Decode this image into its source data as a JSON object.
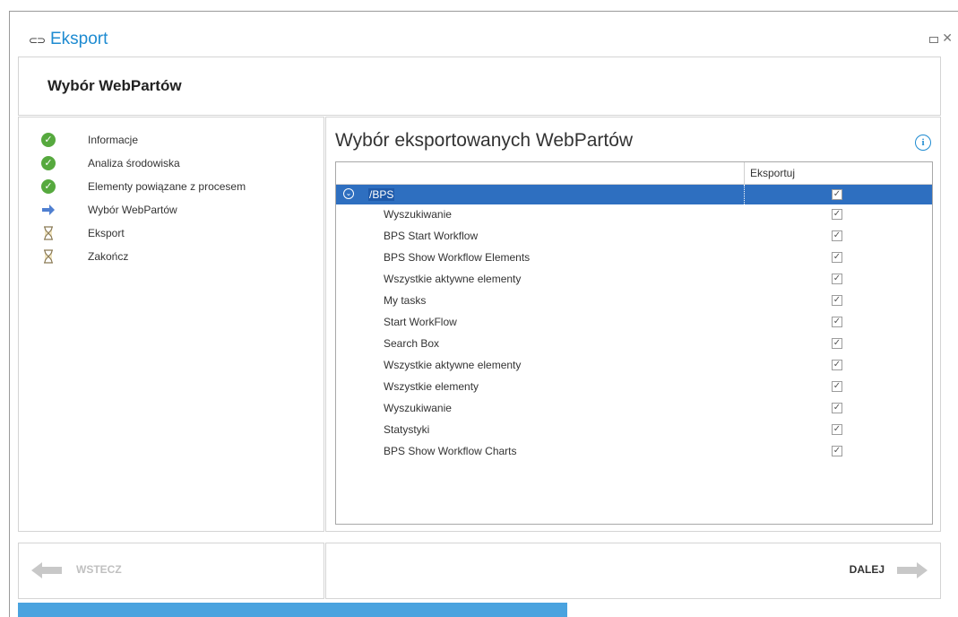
{
  "window": {
    "icon": "link-icon",
    "title": "Eksport",
    "controls": {
      "maximize": "maximize-icon",
      "close": "✕"
    }
  },
  "header": {
    "title": "Wybór WebPartów"
  },
  "steps": [
    {
      "label": "Informacje",
      "state": "done",
      "icon": "check-icon"
    },
    {
      "label": "Analiza środowiska",
      "state": "done",
      "icon": "check-icon"
    },
    {
      "label": "Elementy powiązane z procesem",
      "state": "done",
      "icon": "check-icon"
    },
    {
      "label": "Wybór WebPartów",
      "state": "current",
      "icon": "arrow-right-icon"
    },
    {
      "label": "Eksport",
      "state": "pending",
      "icon": "hourglass-icon"
    },
    {
      "label": "Zakończ",
      "state": "pending",
      "icon": "hourglass-icon"
    }
  ],
  "content": {
    "title": "Wybór eksportowanych WebPartów",
    "info_icon": "i",
    "grid": {
      "column_header": "Eksportuj",
      "root": {
        "name": "/BPS",
        "checked": true
      },
      "rows": [
        {
          "name": "Wyszukiwanie",
          "checked": true
        },
        {
          "name": "BPS Start Workflow",
          "checked": true
        },
        {
          "name": "BPS Show Workflow Elements",
          "checked": true
        },
        {
          "name": "Wszystkie aktywne elementy",
          "checked": true
        },
        {
          "name": "My tasks",
          "checked": true
        },
        {
          "name": "Start WorkFlow",
          "checked": true
        },
        {
          "name": "Search Box",
          "checked": true
        },
        {
          "name": "Wszystkie aktywne elementy",
          "checked": true
        },
        {
          "name": "Wszystkie elementy",
          "checked": true
        },
        {
          "name": "Wyszukiwanie",
          "checked": true
        },
        {
          "name": "Statystyki",
          "checked": true
        },
        {
          "name": "BPS Show Workflow Charts",
          "checked": true
        }
      ]
    }
  },
  "nav": {
    "back_label": "WSTECZ",
    "back_enabled": false,
    "next_label": "DALEJ"
  },
  "progress": {
    "fraction": 0.595,
    "color": "#4aa3df"
  },
  "colors": {
    "accent": "#1e8bd1",
    "selection": "#2e6fc0",
    "ok": "#56a93e"
  }
}
